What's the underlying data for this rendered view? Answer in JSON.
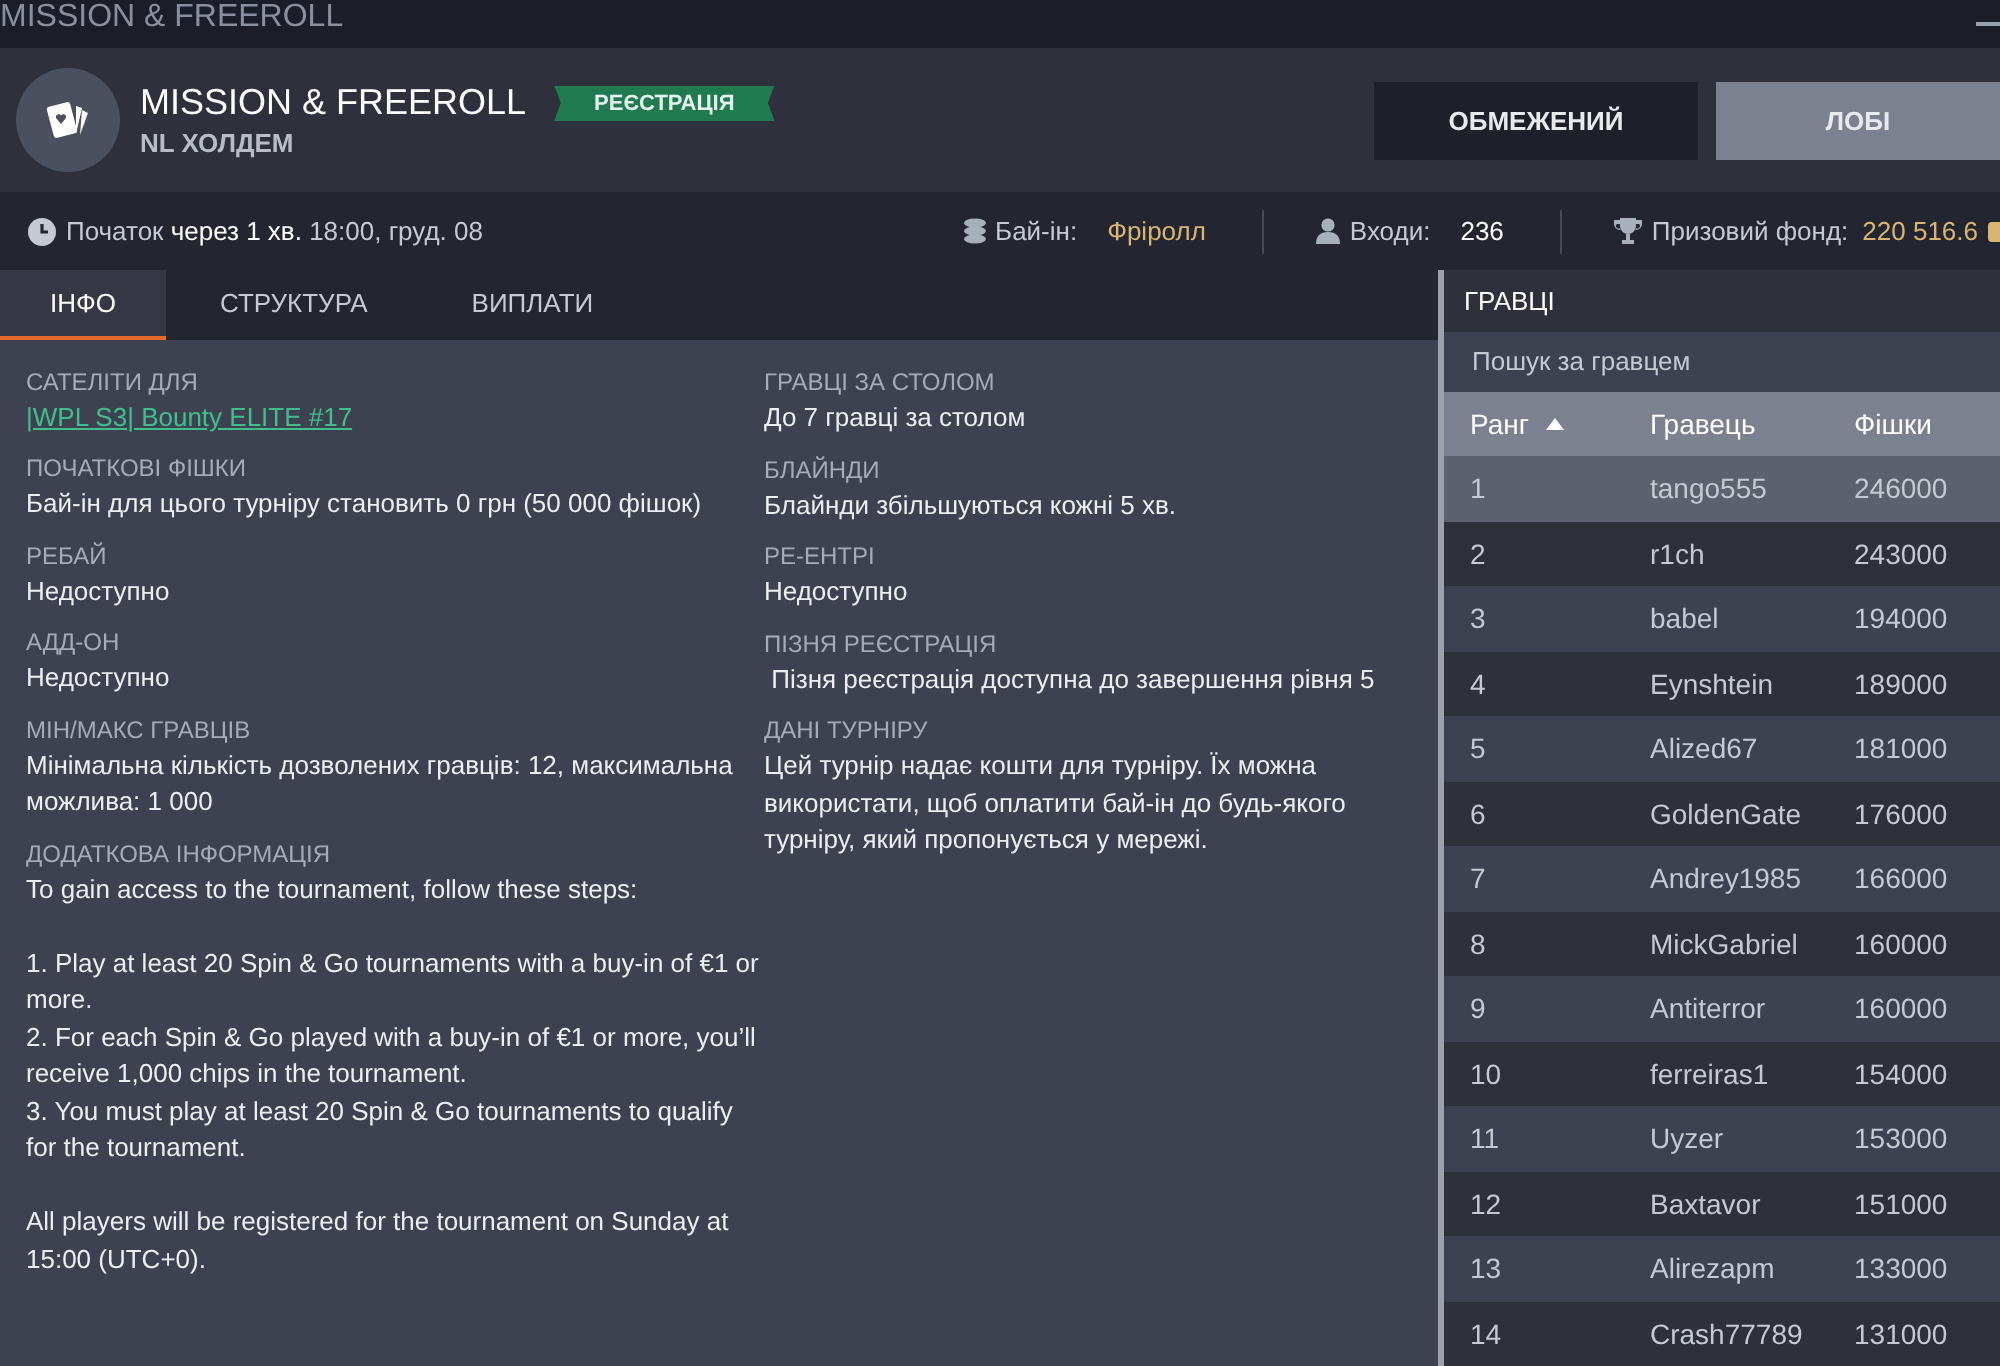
{
  "window": {
    "title": "MISSION & FREEROLL"
  },
  "header": {
    "title": "MISSION & FREEROLL",
    "badge": "РЕЄСТРАЦІЯ",
    "subtitle": "NL ХОЛДЕМ",
    "buttons": [
      {
        "label": "ОБМЕЖЕНИЙ",
        "selected": false
      },
      {
        "label": "ЛОБІ",
        "selected": true
      }
    ]
  },
  "info_bar": {
    "start": "Початок **через 1 хв.** 18:00, груд. 08",
    "buyin_label": "Бай-ін:",
    "buyin_value": "Фріролл",
    "entries_label": "Входи:",
    "entries_value": "236",
    "prize_label": "Призовий фонд:",
    "prize_value": "220 516.6"
  },
  "tabs": [
    {
      "label": "ІНФО",
      "selected": true
    },
    {
      "label": "СТРУКТУРА",
      "selected": false
    },
    {
      "label": "ВИПЛАТИ",
      "selected": false
    }
  ],
  "info_left": [
    {
      "label": "САТЕЛІТИ ДЛЯ",
      "value": "|WPL S3| Bounty ELITE #17",
      "kind": "link"
    },
    {
      "label": "ПОЧАТКОВІ ФІШКИ",
      "value": "Бай-ін для цього турніру становить 0 грн (50 000 фішок)",
      "kind": "text"
    },
    {
      "label": "РЕБАЙ",
      "value": "Недоступно",
      "kind": "text"
    },
    {
      "label": "АДД-ОН",
      "value": "Недоступно",
      "kind": "text"
    },
    {
      "label": "МІН/МАКС ГРАВЦІВ",
      "value": "Мінімальна кількість дозволених гравців: 12, максимальна можлива: 1 000",
      "kind": "text"
    },
    {
      "label": "ДОДАТКОВА ІНФОРМАЦІЯ",
      "value": "To gain access to the tournament, follow these steps:\n\n1. Play at least 20 Spin & Go tournaments with a buy-in of €1 or more.\n2. For each Spin & Go played with a buy-in of €1 or more, you’ll receive 1,000 chips in the tournament.\n3. You must play at least 20 Spin & Go tournaments to qualify for the tournament.\n\nAll players will be registered for the tournament on Sunday at 15:00 (UTC+0).",
      "kind": "text"
    }
  ],
  "info_right": [
    {
      "label": "ГРАВЦІ ЗА СТОЛОМ",
      "value": "До 7 гравці за столом",
      "kind": "text"
    },
    {
      "label": "БЛАЙНДИ",
      "value": "Блайнди збільшуються кожні 5 хв.",
      "kind": "text"
    },
    {
      "label": "РЕ-ЕНТРІ",
      "value": "Недоступно",
      "kind": "text"
    },
    {
      "label": "ПІЗНЯ РЕЄСТРАЦІЯ",
      "value": " Пізня реєстрація доступна до завершення рівня 5",
      "kind": "text"
    },
    {
      "label": "ДАНІ ТУРНІРУ",
      "value": "Цей турнір надає кошти для турніру. Їх можна використати, щоб оплатити бай-ін до будь-якого турніру, який пропонується у мережі.",
      "kind": "text"
    }
  ],
  "players": {
    "title": "ГРАВЦІ",
    "search": {
      "placeholder": "Пошук за гравцем"
    },
    "columns": [
      "Ранг",
      "Гравець",
      "Фішки"
    ],
    "rows": [
      {
        "rank": "1",
        "name": "tango555",
        "chips": "246000",
        "selected": true
      },
      {
        "rank": "2",
        "name": "r1ch",
        "chips": "243000",
        "selected": false
      },
      {
        "rank": "3",
        "name": "babel",
        "chips": "194000",
        "selected": false
      },
      {
        "rank": "4",
        "name": "Eynshtein",
        "chips": "189000",
        "selected": false
      },
      {
        "rank": "5",
        "name": "Alized67",
        "chips": "181000",
        "selected": false
      },
      {
        "rank": "6",
        "name": "GoldenGate",
        "chips": "176000",
        "selected": false
      },
      {
        "rank": "7",
        "name": "Andrey1985",
        "chips": "166000",
        "selected": false
      },
      {
        "rank": "8",
        "name": "MickGabriel",
        "chips": "160000",
        "selected": false
      },
      {
        "rank": "9",
        "name": "Antiterror",
        "chips": "160000",
        "selected": false
      },
      {
        "rank": "10",
        "name": "ferreiras1",
        "chips": "154000",
        "selected": false
      },
      {
        "rank": "11",
        "name": "Uyzer",
        "chips": "153000",
        "selected": false
      },
      {
        "rank": "12",
        "name": "Baxtavor",
        "chips": "151000",
        "selected": false
      },
      {
        "rank": "13",
        "name": "Alirezapm",
        "chips": "133000",
        "selected": false
      },
      {
        "rank": "14",
        "name": "Crash77789",
        "chips": "131000",
        "selected": false
      }
    ]
  }
}
